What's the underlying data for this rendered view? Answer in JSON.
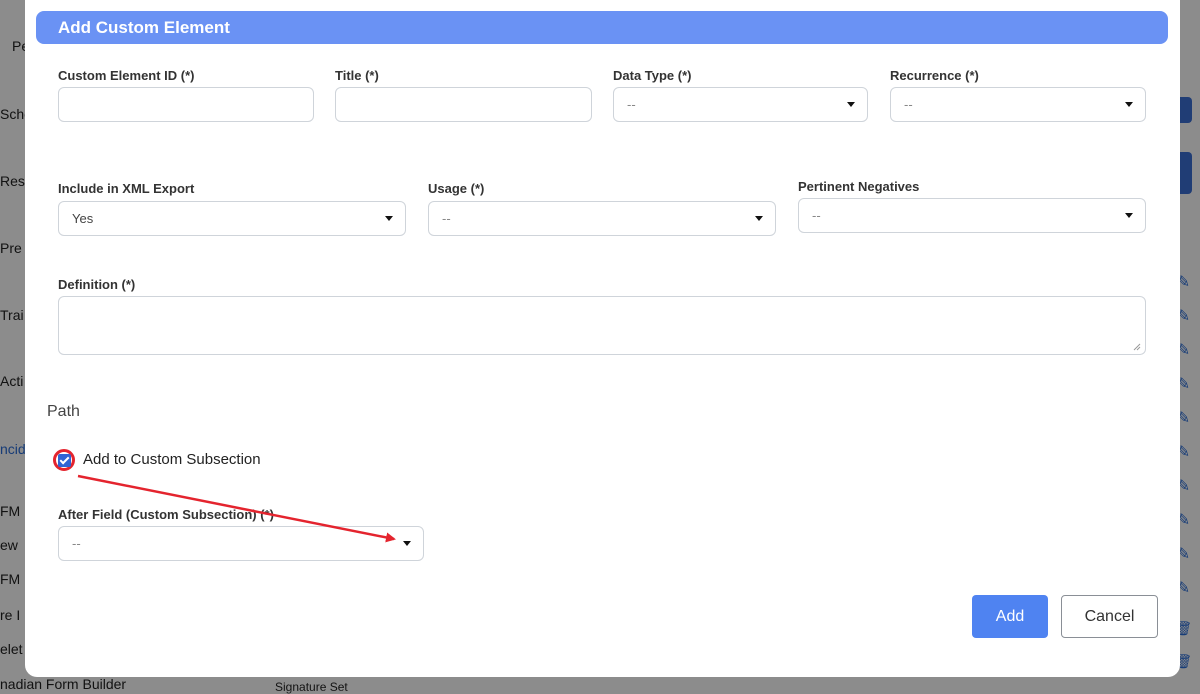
{
  "background": {
    "sidebar_fragments": [
      "Pe",
      "Sche",
      "Resp",
      "Pre",
      "Trai",
      "Acti",
      "ncid",
      "FM",
      "ew",
      "FM",
      "re I",
      "elet",
      "nadian Form Builder"
    ],
    "footer_fragment": "Signature Set"
  },
  "modal": {
    "title": "Add Custom Element",
    "fields": {
      "custom_element_id": {
        "label": "Custom Element ID (*)",
        "value": ""
      },
      "title": {
        "label": "Title (*)",
        "value": ""
      },
      "data_type": {
        "label": "Data Type (*)",
        "value": "--"
      },
      "recurrence": {
        "label": "Recurrence (*)",
        "value": "--"
      },
      "include_xml": {
        "label": "Include in XML Export",
        "value": "Yes"
      },
      "usage": {
        "label": "Usage (*)",
        "value": "--"
      },
      "pertinent_negatives": {
        "label": "Pertinent Negatives",
        "value": "--"
      },
      "definition": {
        "label": "Definition (*)",
        "value": ""
      },
      "after_field": {
        "label": "After Field (Custom Subsection) (*)",
        "value": "--"
      }
    },
    "path": {
      "heading": "Path",
      "checkbox_label": "Add to Custom Subsection",
      "checked": true
    },
    "buttons": {
      "add": "Add",
      "cancel": "Cancel"
    }
  },
  "annotation": {
    "color": "#e4242e"
  },
  "colors": {
    "header": "#6a92f4",
    "primary": "#4f83f1"
  }
}
